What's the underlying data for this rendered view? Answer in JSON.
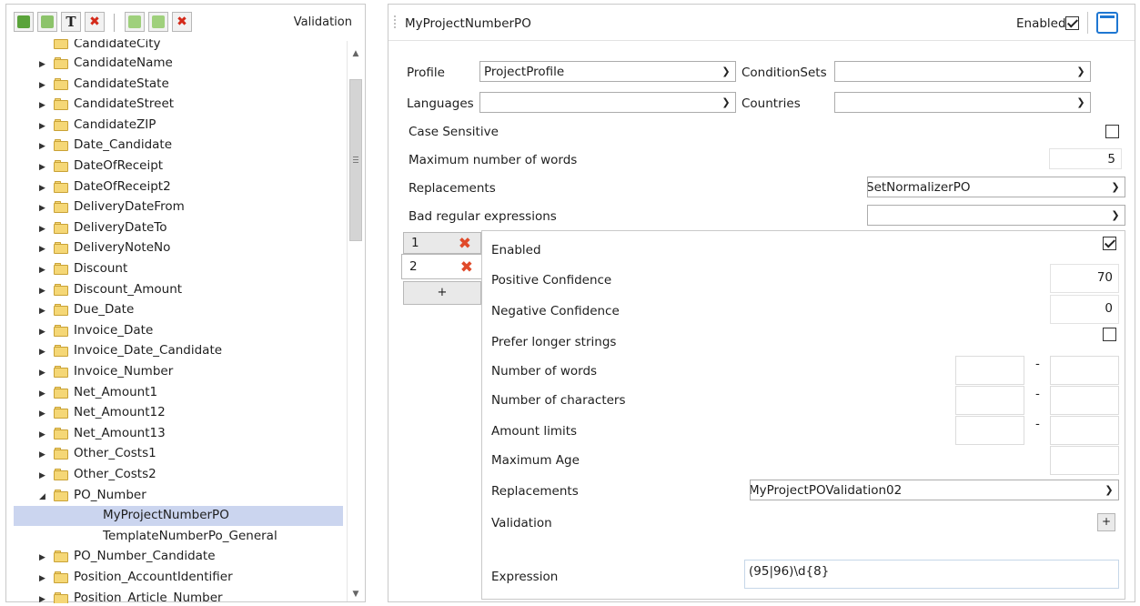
{
  "left_panel": {
    "toolbar_title": "Validation",
    "toolbar_icons": [
      "add-item-icon",
      "add-subitem-icon",
      "text-icon",
      "delete-icon",
      "add-rule-icon",
      "add-rule-alt-icon",
      "delete-rule-icon"
    ],
    "tree_top_partial": "CandidateCity",
    "tree": [
      {
        "label": "CandidateName",
        "type": "folder"
      },
      {
        "label": "CandidateState",
        "type": "folder"
      },
      {
        "label": "CandidateStreet",
        "type": "folder"
      },
      {
        "label": "CandidateZIP",
        "type": "folder"
      },
      {
        "label": "Date_Candidate",
        "type": "folder"
      },
      {
        "label": "DateOfReceipt",
        "type": "folder"
      },
      {
        "label": "DateOfReceipt2",
        "type": "folder"
      },
      {
        "label": "DeliveryDateFrom",
        "type": "folder"
      },
      {
        "label": "DeliveryDateTo",
        "type": "folder"
      },
      {
        "label": "DeliveryNoteNo",
        "type": "folder"
      },
      {
        "label": "Discount",
        "type": "folder"
      },
      {
        "label": "Discount_Amount",
        "type": "folder"
      },
      {
        "label": "Due_Date",
        "type": "folder"
      },
      {
        "label": "Invoice_Date",
        "type": "folder"
      },
      {
        "label": "Invoice_Date_Candidate",
        "type": "folder"
      },
      {
        "label": "Invoice_Number",
        "type": "folder"
      },
      {
        "label": "Net_Amount1",
        "type": "folder"
      },
      {
        "label": "Net_Amount12",
        "type": "folder"
      },
      {
        "label": "Net_Amount13",
        "type": "folder"
      },
      {
        "label": "Other_Costs1",
        "type": "folder"
      },
      {
        "label": "Other_Costs2",
        "type": "folder"
      },
      {
        "label": "PO_Number",
        "type": "folder-expanded"
      },
      {
        "label": "MyProjectNumberPO",
        "type": "child-selected"
      },
      {
        "label": "TemplateNumberPo_General",
        "type": "child"
      },
      {
        "label": "PO_Number_Candidate",
        "type": "folder"
      },
      {
        "label": "Position_AccountIdentifier",
        "type": "folder"
      },
      {
        "label": "Position_Article_Number",
        "type": "folder"
      }
    ]
  },
  "right_panel": {
    "title": "MyProjectNumberPO",
    "enabled_label": "Enabled",
    "enabled_checked": true,
    "profile_label": "Profile",
    "profile_value": "ProjectProfile",
    "conditionsets_label": "ConditionSets",
    "conditionsets_value": "",
    "languages_label": "Languages",
    "languages_value": "",
    "countries_label": "Countries",
    "countries_value": "",
    "case_sensitive_label": "Case Sensitive",
    "case_sensitive_checked": false,
    "max_words_label": "Maximum number of words",
    "max_words_value": "5",
    "replacements_label": "Replacements",
    "replacements_value": "SetNormalizerPO",
    "bad_regex_label": "Bad regular expressions",
    "bad_regex_value": "",
    "rule_tabs": [
      {
        "num": "1",
        "active": false
      },
      {
        "num": "2",
        "active": true
      }
    ],
    "add_rule_label": "+",
    "rule": {
      "enabled_label": "Enabled",
      "enabled_checked": true,
      "pos_conf_label": "Positive Confidence",
      "pos_conf_value": "70",
      "neg_conf_label": "Negative Confidence",
      "neg_conf_value": "0",
      "prefer_longer_label": "Prefer longer strings",
      "prefer_longer_checked": false,
      "num_words_label": "Number of words",
      "num_chars_label": "Number of characters",
      "amount_limits_label": "Amount limits",
      "range_dash": "-",
      "max_age_label": "Maximum Age",
      "replacements_label": "Replacements",
      "replacements_value": "MyProjectPOValidation02",
      "validation_label": "Validation",
      "validation_add": "+",
      "expression_label": "Expression",
      "expression_value": "(95|96)\\d{8}"
    }
  }
}
